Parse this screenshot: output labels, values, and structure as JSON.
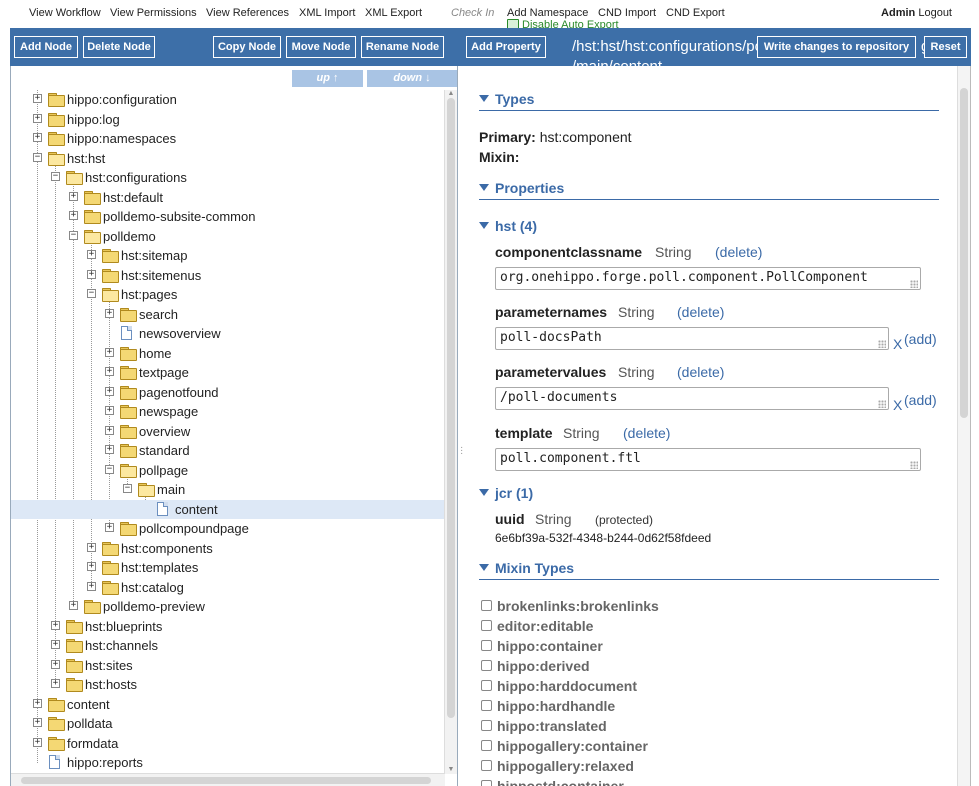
{
  "topmenu": {
    "view_workflow": "View Workflow",
    "view_permissions": "View Permissions",
    "view_references": "View References",
    "xml_import": "XML Import",
    "xml_export": "XML Export",
    "check_in": "Check In",
    "add_namespace": "Add Namespace",
    "cnd_import": "CND Import",
    "cnd_export": "CND Export",
    "disable_auto_export": "Disable Auto Export",
    "user": "Admin",
    "logout": "Logout"
  },
  "toolbar": {
    "add_node": "Add Node",
    "delete_node": "Delete Node",
    "copy_node": "Copy Node",
    "move_node": "Move Node",
    "rename_node": "Rename Node",
    "add_property": "Add Property",
    "path_line1": "/hst:hst/hst:configurations/po",
    "path_line1_tail": "ge",
    "path_line2": "/main/content",
    "write_changes": "Write changes to repository",
    "reset": "Reset"
  },
  "tree_controls": {
    "up": "up ↑",
    "down": "down ↓"
  },
  "tree": [
    {
      "label": "hippo:configuration",
      "depth": 0,
      "type": "folder",
      "expander": "+"
    },
    {
      "label": "hippo:log",
      "depth": 0,
      "type": "folder",
      "expander": "+"
    },
    {
      "label": "hippo:namespaces",
      "depth": 0,
      "type": "folder",
      "expander": "+"
    },
    {
      "label": "hst:hst",
      "depth": 0,
      "type": "folder-open",
      "expander": "−"
    },
    {
      "label": "hst:configurations",
      "depth": 1,
      "type": "folder-open",
      "expander": "−"
    },
    {
      "label": "hst:default",
      "depth": 2,
      "type": "folder",
      "expander": "+"
    },
    {
      "label": "polldemo-subsite-common",
      "depth": 2,
      "type": "folder",
      "expander": "+"
    },
    {
      "label": "polldemo",
      "depth": 2,
      "type": "folder-open",
      "expander": "−"
    },
    {
      "label": "hst:sitemap",
      "depth": 3,
      "type": "folder",
      "expander": "+"
    },
    {
      "label": "hst:sitemenus",
      "depth": 3,
      "type": "folder",
      "expander": "+"
    },
    {
      "label": "hst:pages",
      "depth": 3,
      "type": "folder-open",
      "expander": "−"
    },
    {
      "label": "search",
      "depth": 4,
      "type": "folder",
      "expander": "+"
    },
    {
      "label": "newsoverview",
      "depth": 4,
      "type": "doc",
      "expander": ""
    },
    {
      "label": "home",
      "depth": 4,
      "type": "folder",
      "expander": "+"
    },
    {
      "label": "textpage",
      "depth": 4,
      "type": "folder",
      "expander": "+"
    },
    {
      "label": "pagenotfound",
      "depth": 4,
      "type": "folder",
      "expander": "+"
    },
    {
      "label": "newspage",
      "depth": 4,
      "type": "folder",
      "expander": "+"
    },
    {
      "label": "overview",
      "depth": 4,
      "type": "folder",
      "expander": "+"
    },
    {
      "label": "standard",
      "depth": 4,
      "type": "folder",
      "expander": "+"
    },
    {
      "label": "pollpage",
      "depth": 4,
      "type": "folder-open",
      "expander": "−"
    },
    {
      "label": "main",
      "depth": 5,
      "type": "folder-open",
      "expander": "−"
    },
    {
      "label": "content",
      "depth": 6,
      "type": "doc",
      "expander": "",
      "selected": true
    },
    {
      "label": "pollcompoundpage",
      "depth": 4,
      "type": "folder",
      "expander": "+"
    },
    {
      "label": "hst:components",
      "depth": 3,
      "type": "folder",
      "expander": "+"
    },
    {
      "label": "hst:templates",
      "depth": 3,
      "type": "folder",
      "expander": "+"
    },
    {
      "label": "hst:catalog",
      "depth": 3,
      "type": "folder",
      "expander": "+"
    },
    {
      "label": "polldemo-preview",
      "depth": 2,
      "type": "folder",
      "expander": "+"
    },
    {
      "label": "hst:blueprints",
      "depth": 1,
      "type": "folder",
      "expander": "+"
    },
    {
      "label": "hst:channels",
      "depth": 1,
      "type": "folder",
      "expander": "+"
    },
    {
      "label": "hst:sites",
      "depth": 1,
      "type": "folder",
      "expander": "+"
    },
    {
      "label": "hst:hosts",
      "depth": 1,
      "type": "folder",
      "expander": "+"
    },
    {
      "label": "content",
      "depth": 0,
      "type": "folder",
      "expander": "+"
    },
    {
      "label": "polldata",
      "depth": 0,
      "type": "folder",
      "expander": "+"
    },
    {
      "label": "formdata",
      "depth": 0,
      "type": "folder",
      "expander": "+"
    },
    {
      "label": "hippo:reports",
      "depth": 0,
      "type": "doc",
      "expander": ""
    }
  ],
  "types": {
    "heading": "Types",
    "primary_label": "Primary:",
    "primary_value": "hst:component",
    "mixin_label": "Mixin:"
  },
  "properties": {
    "heading": "Properties",
    "hst_group": "hst (4)",
    "jcr_group": "jcr (1)",
    "delete_label": "(delete)",
    "add_label": "(add)",
    "remove_x": "X",
    "items": {
      "componentclassname": {
        "name": "componentclassname",
        "type": "String",
        "value": "org.onehippo.forge.poll.component.PollComponent"
      },
      "parameternames": {
        "name": "parameternames",
        "type": "String",
        "value": "poll-docsPath"
      },
      "parametervalues": {
        "name": "parametervalues",
        "type": "String",
        "value": "/poll-documents"
      },
      "template": {
        "name": "template",
        "type": "String",
        "value": "poll.component.ftl"
      }
    },
    "uuid": {
      "name": "uuid",
      "type": "String",
      "protected": "(protected)",
      "value": "6e6bf39a-532f-4348-b244-0d62f58fdeed"
    }
  },
  "mixin_types": {
    "heading": "Mixin Types",
    "items": [
      "brokenlinks:brokenlinks",
      "editor:editable",
      "hippo:container",
      "hippo:derived",
      "hippo:harddocument",
      "hippo:hardhandle",
      "hippo:translated",
      "hippogallery:container",
      "hippogallery:relaxed",
      "hippostd:container"
    ]
  },
  "colors": {
    "toolbar_bg": "#3d6fa8",
    "accent_link": "#3b6aa7",
    "selection_bg": "#dde8f6"
  }
}
